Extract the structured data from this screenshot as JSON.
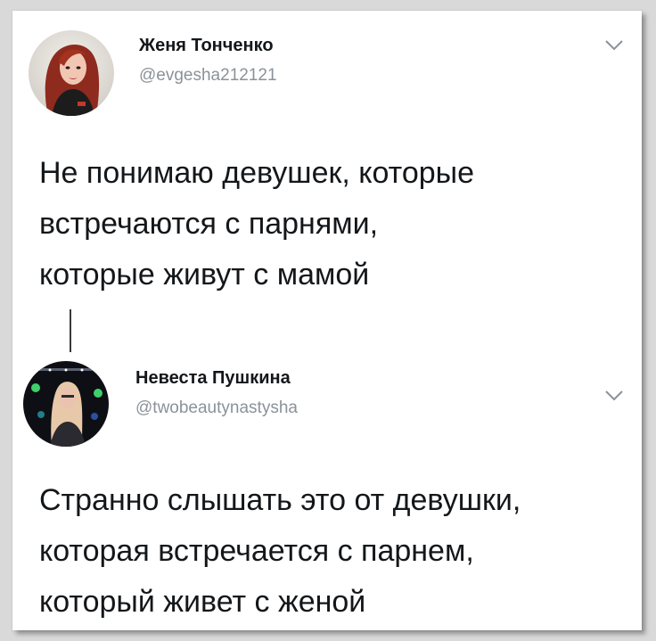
{
  "tweets": [
    {
      "display_name": "Женя Тонченко",
      "handle": "@evgesha212121",
      "text_lines": [
        "Не понимаю девушек, которые",
        "встречаются с парнями,",
        "которые живут с мамой"
      ],
      "avatar_icon": "user-avatar-photo",
      "menu_icon": "chevron-down-icon"
    },
    {
      "display_name": "Невеста Пушкина",
      "handle": "@twobeautynastysha",
      "text_lines": [
        "Странно слышать это от девушки,",
        "которая встречается с парнем,",
        "который живет с женой"
      ],
      "avatar_icon": "user-avatar-photo",
      "menu_icon": "chevron-down-icon"
    }
  ],
  "colors": {
    "background": "#d9d9d9",
    "card": "#ffffff",
    "text_primary": "#14171a",
    "text_secondary": "#8a9299",
    "thread_line": "#3a3a3a"
  }
}
